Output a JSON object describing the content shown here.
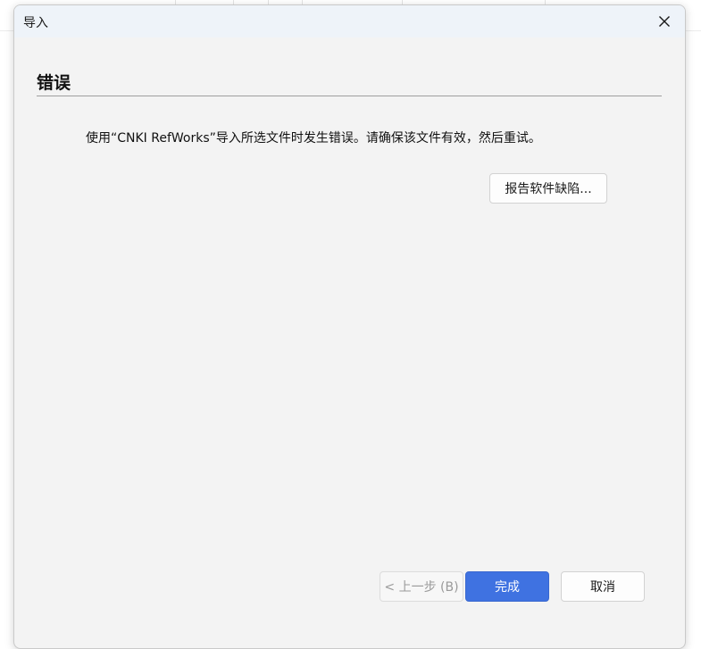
{
  "dialog": {
    "title": "导入",
    "heading": "错误",
    "message": "使用“CNKI RefWorks”导入所选文件时发生错误。请确保该文件有效，然后重试。",
    "report_button_label": "报告软件缺陷...",
    "close_icon": "close-icon"
  },
  "footer": {
    "back_label": "< 上一步 (B)",
    "finish_label": "完成",
    "cancel_label": "取消"
  },
  "colors": {
    "accent": "#3f72e1",
    "dialog_background": "#f3f3f3",
    "titlebar_background": "#eef3f9"
  }
}
